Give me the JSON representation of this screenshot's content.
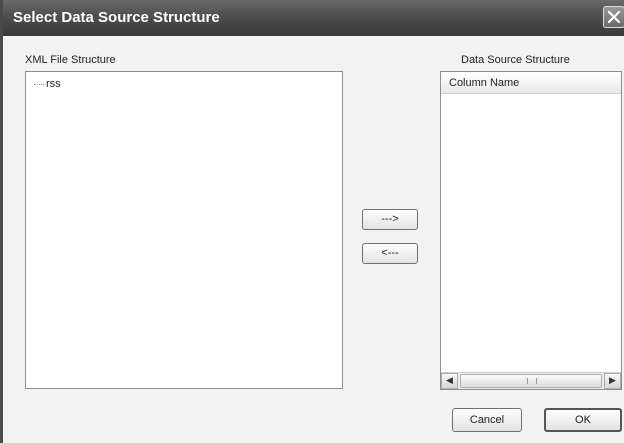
{
  "dialog": {
    "title": "Select Data Source Structure",
    "close_icon": "close-icon"
  },
  "left_panel": {
    "label": "XML File Structure",
    "tree": [
      {
        "label": "rss"
      }
    ]
  },
  "right_panel": {
    "label": "Data Source Structure",
    "column_header": "Column Name"
  },
  "transfer_buttons": {
    "add": "--->",
    "remove": "<---"
  },
  "footer": {
    "cancel": "Cancel",
    "ok": "OK"
  }
}
